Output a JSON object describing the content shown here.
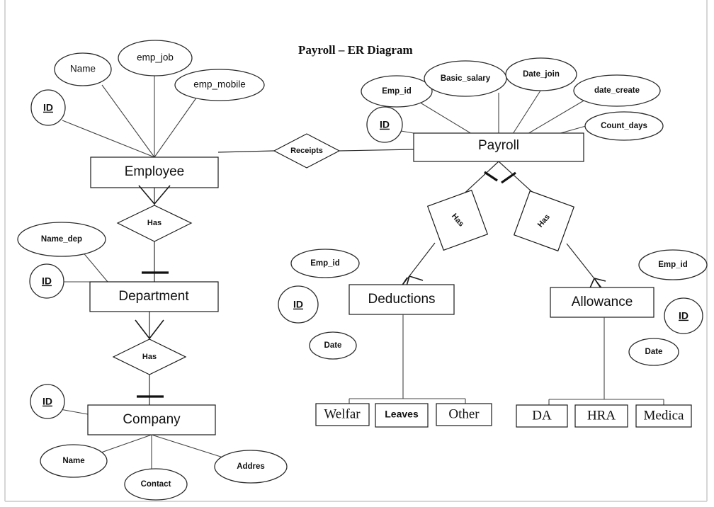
{
  "title": "Payroll – ER Diagram",
  "colors": {
    "stroke": "#1a1a1a",
    "background": "#ffffff",
    "page_edge": "#d6d6d6"
  },
  "entities": [
    {
      "id": "employee",
      "label": "Employee"
    },
    {
      "id": "payroll",
      "label": "Payroll"
    },
    {
      "id": "department",
      "label": "Department"
    },
    {
      "id": "company",
      "label": "Company"
    },
    {
      "id": "deductions",
      "label": "Deductions"
    },
    {
      "id": "allowance",
      "label": "Allowance"
    }
  ],
  "relationships": [
    {
      "id": "receipts",
      "label": "Receipts"
    },
    {
      "id": "emp-dept-has",
      "label": "Has"
    },
    {
      "id": "dept-company-has",
      "label": "Has"
    },
    {
      "id": "payroll-ded-has",
      "label": "Has"
    },
    {
      "id": "payroll-allow-has",
      "label": "Has"
    }
  ],
  "attributes": {
    "employee": [
      {
        "id": "employee-id",
        "label": "ID",
        "key": true
      },
      {
        "id": "employee-name",
        "label": "Name",
        "key": false
      },
      {
        "id": "employee-emp-job",
        "label": "emp_job",
        "key": false
      },
      {
        "id": "employee-emp-mobile",
        "label": "emp_mobile",
        "key": false
      }
    ],
    "payroll": [
      {
        "id": "payroll-id",
        "label": "ID",
        "key": true
      },
      {
        "id": "payroll-emp-id",
        "label": "Emp_id",
        "key": false
      },
      {
        "id": "payroll-basic-salary",
        "label": "Basic_salary",
        "key": false
      },
      {
        "id": "payroll-date-join",
        "label": "Date_join",
        "key": false
      },
      {
        "id": "payroll-date-create",
        "label": "date_create",
        "key": false
      },
      {
        "id": "payroll-count-days",
        "label": "Count_days",
        "key": false
      }
    ],
    "department": [
      {
        "id": "department-id",
        "label": "ID",
        "key": true
      },
      {
        "id": "department-name-dep",
        "label": "Name_dep",
        "key": false
      }
    ],
    "company": [
      {
        "id": "company-id",
        "label": "ID",
        "key": true
      },
      {
        "id": "company-name",
        "label": "Name",
        "key": false
      },
      {
        "id": "company-contact",
        "label": "Contact",
        "key": false
      },
      {
        "id": "company-addres",
        "label": "Addres",
        "key": false
      }
    ],
    "deductions": [
      {
        "id": "deductions-id",
        "label": "ID",
        "key": true
      },
      {
        "id": "deductions-emp-id",
        "label": "Emp_id",
        "key": false
      },
      {
        "id": "deductions-date",
        "label": "Date",
        "key": false
      }
    ],
    "allowance": [
      {
        "id": "allowance-id",
        "label": "ID",
        "key": true
      },
      {
        "id": "allowance-emp-id",
        "label": "Emp_id",
        "key": false
      },
      {
        "id": "allowance-date",
        "label": "Date",
        "key": false
      }
    ]
  },
  "subtypes": {
    "deductions": [
      {
        "id": "deduction-welfar",
        "label": "Welfar"
      },
      {
        "id": "deduction-leaves",
        "label": "Leaves"
      },
      {
        "id": "deduction-other",
        "label": "Other"
      }
    ],
    "allowance": [
      {
        "id": "allowance-da",
        "label": "DA"
      },
      {
        "id": "allowance-hra",
        "label": "HRA"
      },
      {
        "id": "allowance-medica",
        "label": "Medica"
      }
    ]
  }
}
